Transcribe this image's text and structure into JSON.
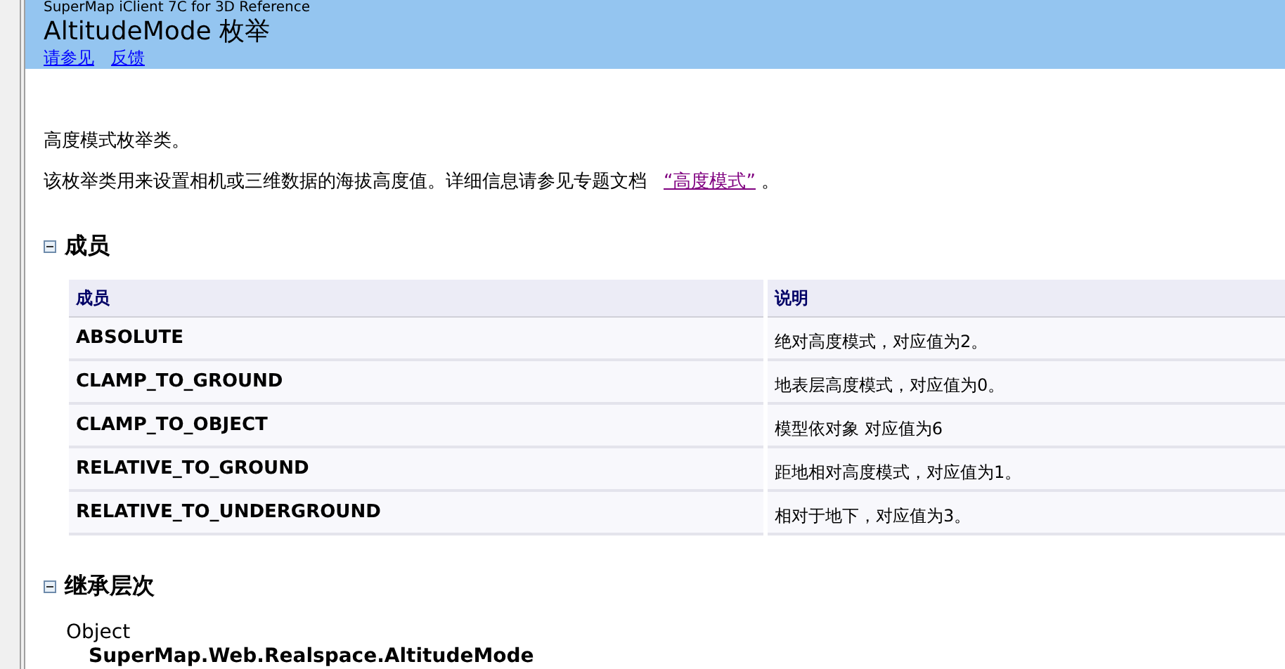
{
  "header": {
    "product": "SuperMap iClient 7C for 3D Reference",
    "title": "AltitudeMode 枚举",
    "links": [
      "请参见",
      "反馈"
    ]
  },
  "summary": "高度模式枚举类。",
  "description": {
    "text": "该枚举类用来设置相机或三维数据的海拔高度值。详细信息请参见专题文档",
    "link": "“高度模式”",
    "end": "。"
  },
  "members": {
    "heading": "成员",
    "expanded": true,
    "columns": [
      "成员",
      "说明"
    ],
    "rows": [
      [
        "ABSOLUTE",
        "绝对高度模式，对应值为2。"
      ],
      [
        "CLAMP_TO_GROUND",
        "地表层高度模式，对应值为0。"
      ],
      [
        "CLAMP_TO_OBJECT",
        "模型依对象 对应值为6"
      ],
      [
        "RELATIVE_TO_GROUND",
        "距地相对高度模式，对应值为1。"
      ],
      [
        "RELATIVE_TO_UNDERGROUND",
        "相对于地下，对应值为3。"
      ]
    ]
  },
  "hierarchy": {
    "heading": "继承层次",
    "expanded": true,
    "items": [
      {
        "text": "Object",
        "current": false,
        "children": [
          {
            "text": "SuperMap.Web.Realspace.AltitudeMode",
            "current": true
          }
        ]
      }
    ]
  }
}
